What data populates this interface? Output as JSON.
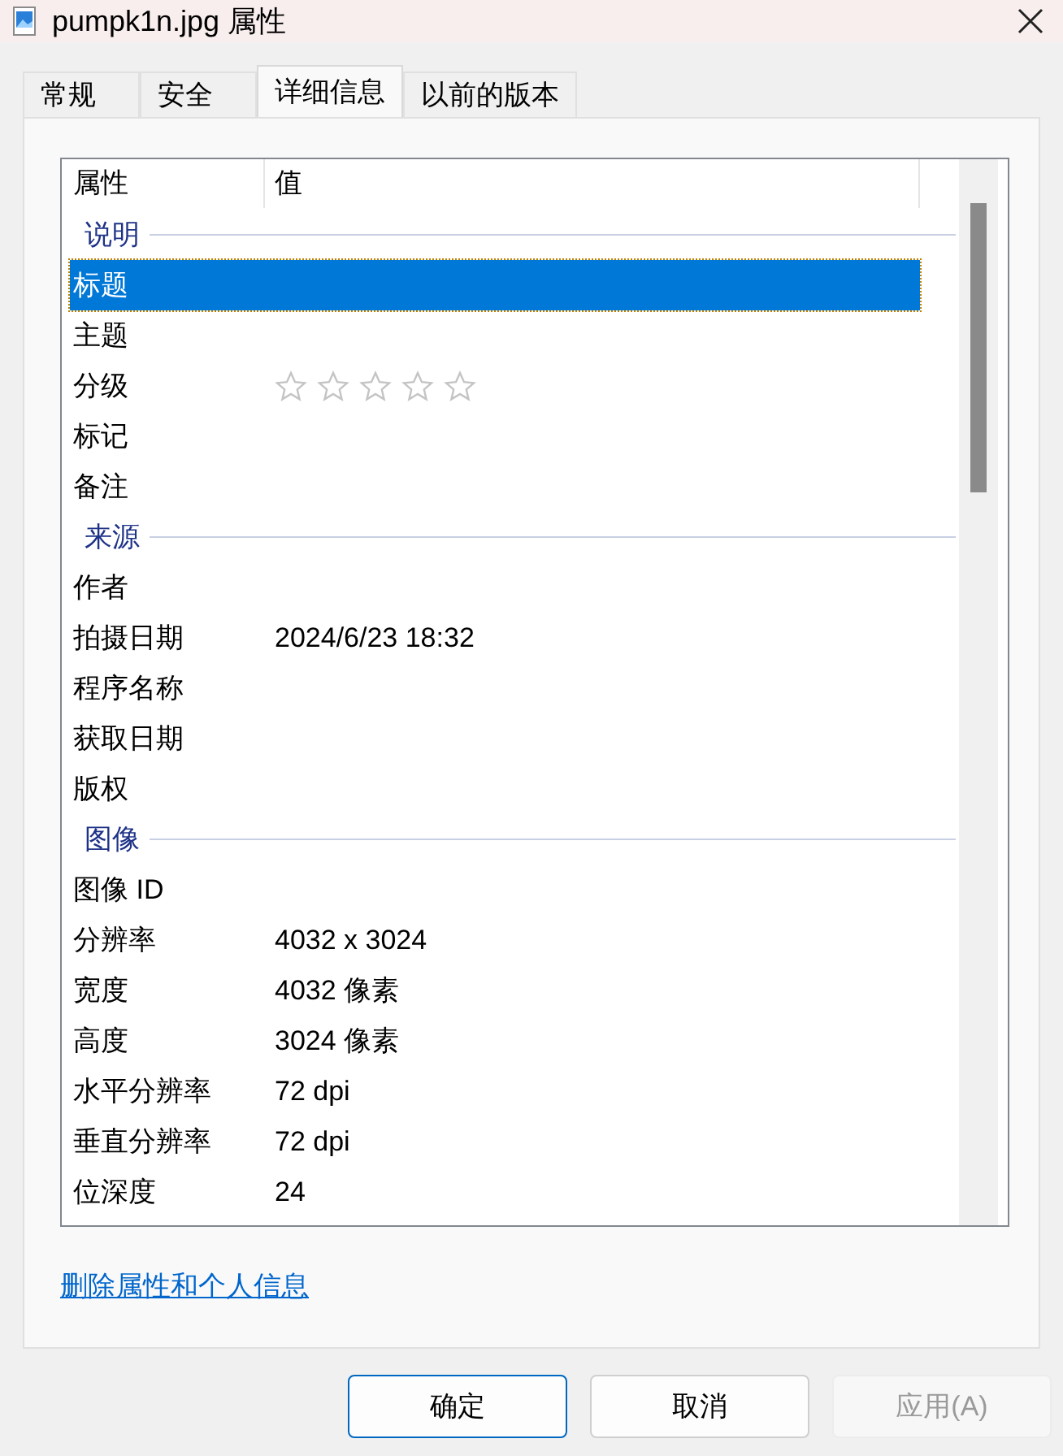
{
  "window": {
    "title": "pumpk1n.jpg 属性"
  },
  "tabs": [
    {
      "label": "常规",
      "selected": false
    },
    {
      "label": "安全",
      "selected": false
    },
    {
      "label": "详细信息",
      "selected": true
    },
    {
      "label": "以前的版本",
      "selected": false
    }
  ],
  "table": {
    "columns": [
      "属性",
      "值"
    ],
    "sections": [
      {
        "heading": "说明",
        "rows": [
          {
            "kind": "text",
            "label": "标题",
            "selected": true
          },
          {
            "kind": "text",
            "label": "主题",
            "selected": false
          },
          {
            "kind": "stars",
            "label": "分级",
            "selected": false,
            "stars": 0
          },
          {
            "kind": "text",
            "label": "标记",
            "selected": false
          },
          {
            "kind": "text",
            "label": "备注",
            "selected": false
          }
        ]
      },
      {
        "heading": "来源",
        "rows": [
          {
            "kind": "text",
            "label": "作者",
            "selected": false
          },
          {
            "kind": "text",
            "label": "拍摄日期",
            "value": "2024/6/23 18:32",
            "selected": false
          },
          {
            "kind": "text",
            "label": "程序名称",
            "selected": false
          },
          {
            "kind": "text",
            "label": "获取日期",
            "selected": false
          },
          {
            "kind": "text",
            "label": "版权",
            "selected": false
          }
        ]
      },
      {
        "heading": "图像",
        "rows": [
          {
            "kind": "text",
            "label": "图像 ID",
            "selected": false
          },
          {
            "kind": "text",
            "label": "分辨率",
            "value": "4032 x 3024",
            "selected": false
          },
          {
            "kind": "text",
            "label": "宽度",
            "value": "4032 像素",
            "selected": false
          },
          {
            "kind": "text",
            "label": "高度",
            "value": "3024 像素",
            "selected": false
          },
          {
            "kind": "text",
            "label": "水平分辨率",
            "value": "72 dpi",
            "selected": false
          },
          {
            "kind": "text",
            "label": "垂直分辨率",
            "value": "72 dpi",
            "selected": false
          },
          {
            "kind": "text",
            "label": "位深度",
            "value": "24",
            "selected": false
          }
        ]
      }
    ]
  },
  "link": "删除属性和个人信息",
  "buttons": [
    {
      "label": "确定",
      "kind": "default",
      "disabled": false
    },
    {
      "label": "取消",
      "kind": "normal",
      "disabled": false
    },
    {
      "label": "应用(A)",
      "kind": "normal",
      "disabled": true
    }
  ]
}
